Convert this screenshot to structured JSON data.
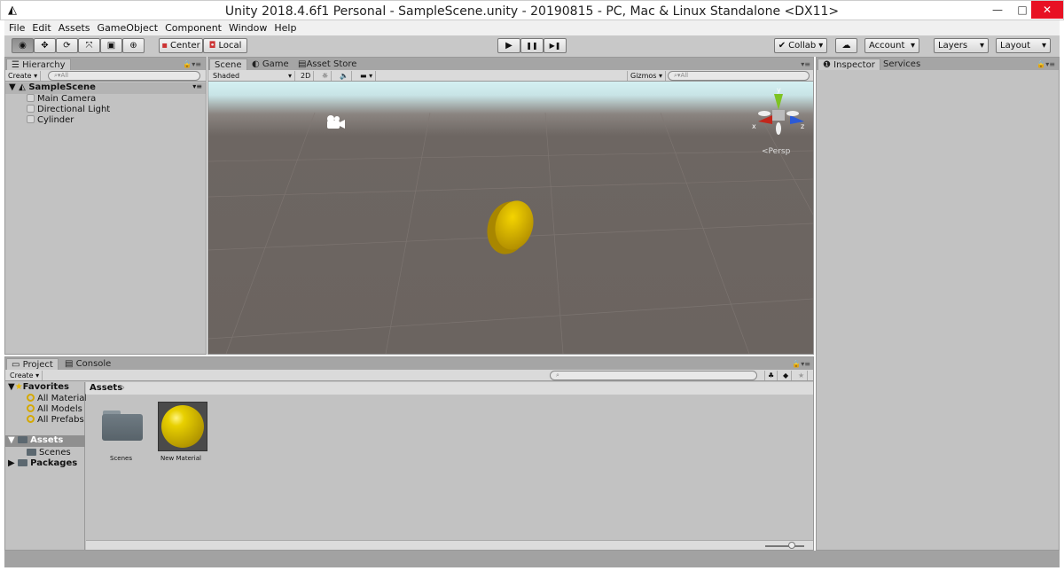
{
  "window": {
    "title": "Unity 2018.4.6f1 Personal - SampleScene.unity - 20190815 - PC, Mac & Linux Standalone <DX11>",
    "minimize": "—",
    "maximize": "□",
    "close": "✕"
  },
  "menu": [
    "File",
    "Edit",
    "Assets",
    "GameObject",
    "Component",
    "Window",
    "Help"
  ],
  "toolbar": {
    "tools": [
      "view-tool",
      "move-tool",
      "rotate-tool",
      "scale-tool",
      "rect-tool",
      "transform-tool"
    ],
    "center": "Center",
    "local": "Local",
    "collab": "Collab",
    "account": "Account",
    "layers": "Layers",
    "layout": "Layout",
    "play": "▶",
    "pause": "❚❚",
    "step": "▶❚"
  },
  "hierarchy": {
    "tab": "Hierarchy",
    "create": "Create",
    "search_placeholder": "All",
    "scene": "SampleScene",
    "items": [
      "Main Camera",
      "Directional Light",
      "Cylinder"
    ]
  },
  "scene": {
    "tabs": [
      "Scene",
      "Game",
      "Asset Store"
    ],
    "shading": "Shaded",
    "mode2d": "2D",
    "gizmos": "Gizmos",
    "search_placeholder": "All",
    "persp": "Persp",
    "axes": {
      "x": "x",
      "y": "y",
      "z": "z"
    },
    "colors": {
      "object": "#d4b000",
      "sky": "#d4f0f2",
      "ground": "#6b6460"
    }
  },
  "inspector": {
    "tabs": [
      "Inspector",
      "Services"
    ]
  },
  "project": {
    "tabs": [
      "Project",
      "Console"
    ],
    "create": "Create",
    "favorites": "Favorites",
    "fav_items": [
      "All Materials",
      "All Models",
      "All Prefabs"
    ],
    "assets": "Assets",
    "assets_children": [
      "Scenes"
    ],
    "packages": "Packages",
    "breadcrumb": "Assets",
    "files": [
      {
        "name": "Scenes",
        "type": "folder"
      },
      {
        "name": "New Material",
        "type": "material"
      }
    ],
    "zoom_slider": 0.8
  }
}
